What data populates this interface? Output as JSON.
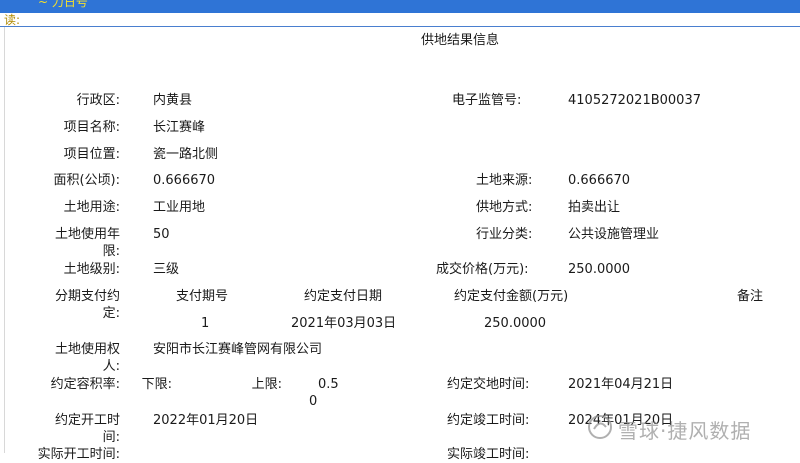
{
  "header": {
    "top_text": "~ 力日号",
    "sub_text": "读:"
  },
  "page_title": "供地结果信息",
  "fields": {
    "district_label": "行政区:",
    "district_value": "内黄县",
    "supervision_no_label": "电子监管号:",
    "supervision_no_value": "4105272021B00037",
    "project_name_label": "项目名称:",
    "project_name_value": "长江赛峰",
    "project_location_label": "项目位置:",
    "project_location_value": "瓷一路北侧",
    "area_label": "面积(公顷):",
    "area_value": "0.666670",
    "land_source_label": "土地来源:",
    "land_source_value": "0.666670",
    "land_use_label": "土地用途:",
    "land_use_value": "工业用地",
    "supply_method_label": "供地方式:",
    "supply_method_value": "拍卖出让",
    "use_years_label": "土地使用年限:",
    "use_years_value": "50",
    "industry_label": "行业分类:",
    "industry_value": "公共设施管理业",
    "land_grade_label": "土地级别:",
    "land_grade_value": "三级",
    "deal_price_label": "成交价格(万元):",
    "deal_price_value": "250.0000",
    "installment_label": "分期支付约定:",
    "installment_headers": [
      "支付期号",
      "约定支付日期",
      "约定支付金额(万元)",
      "备注"
    ],
    "installment_rows": [
      [
        "1",
        "2021年03月03日",
        "250.0000",
        ""
      ]
    ],
    "land_user_label": "土地使用权人:",
    "land_user_value": "安阳市长江赛峰管网有限公司",
    "plot_ratio_label": "约定容积率:",
    "plot_ratio_lower_label": "下限:",
    "plot_ratio_lower_value": "0.5",
    "plot_ratio_upper_label": "上限:",
    "plot_ratio_upper_value": "0",
    "handover_time_label": "约定交地时间:",
    "handover_time_value": "2021年04月21日",
    "start_time_label": "约定开工时间:",
    "start_time_value": "2022年01月20日",
    "completion_time_label": "约定竣工时间:",
    "completion_time_value": "2024年01月20日",
    "actual_start_label": "实际开工时间:",
    "actual_completion_label": "实际竣工时间:"
  },
  "watermark": {
    "text": "雪球·捷风数据",
    "icon": "snowball-logo-icon"
  }
}
